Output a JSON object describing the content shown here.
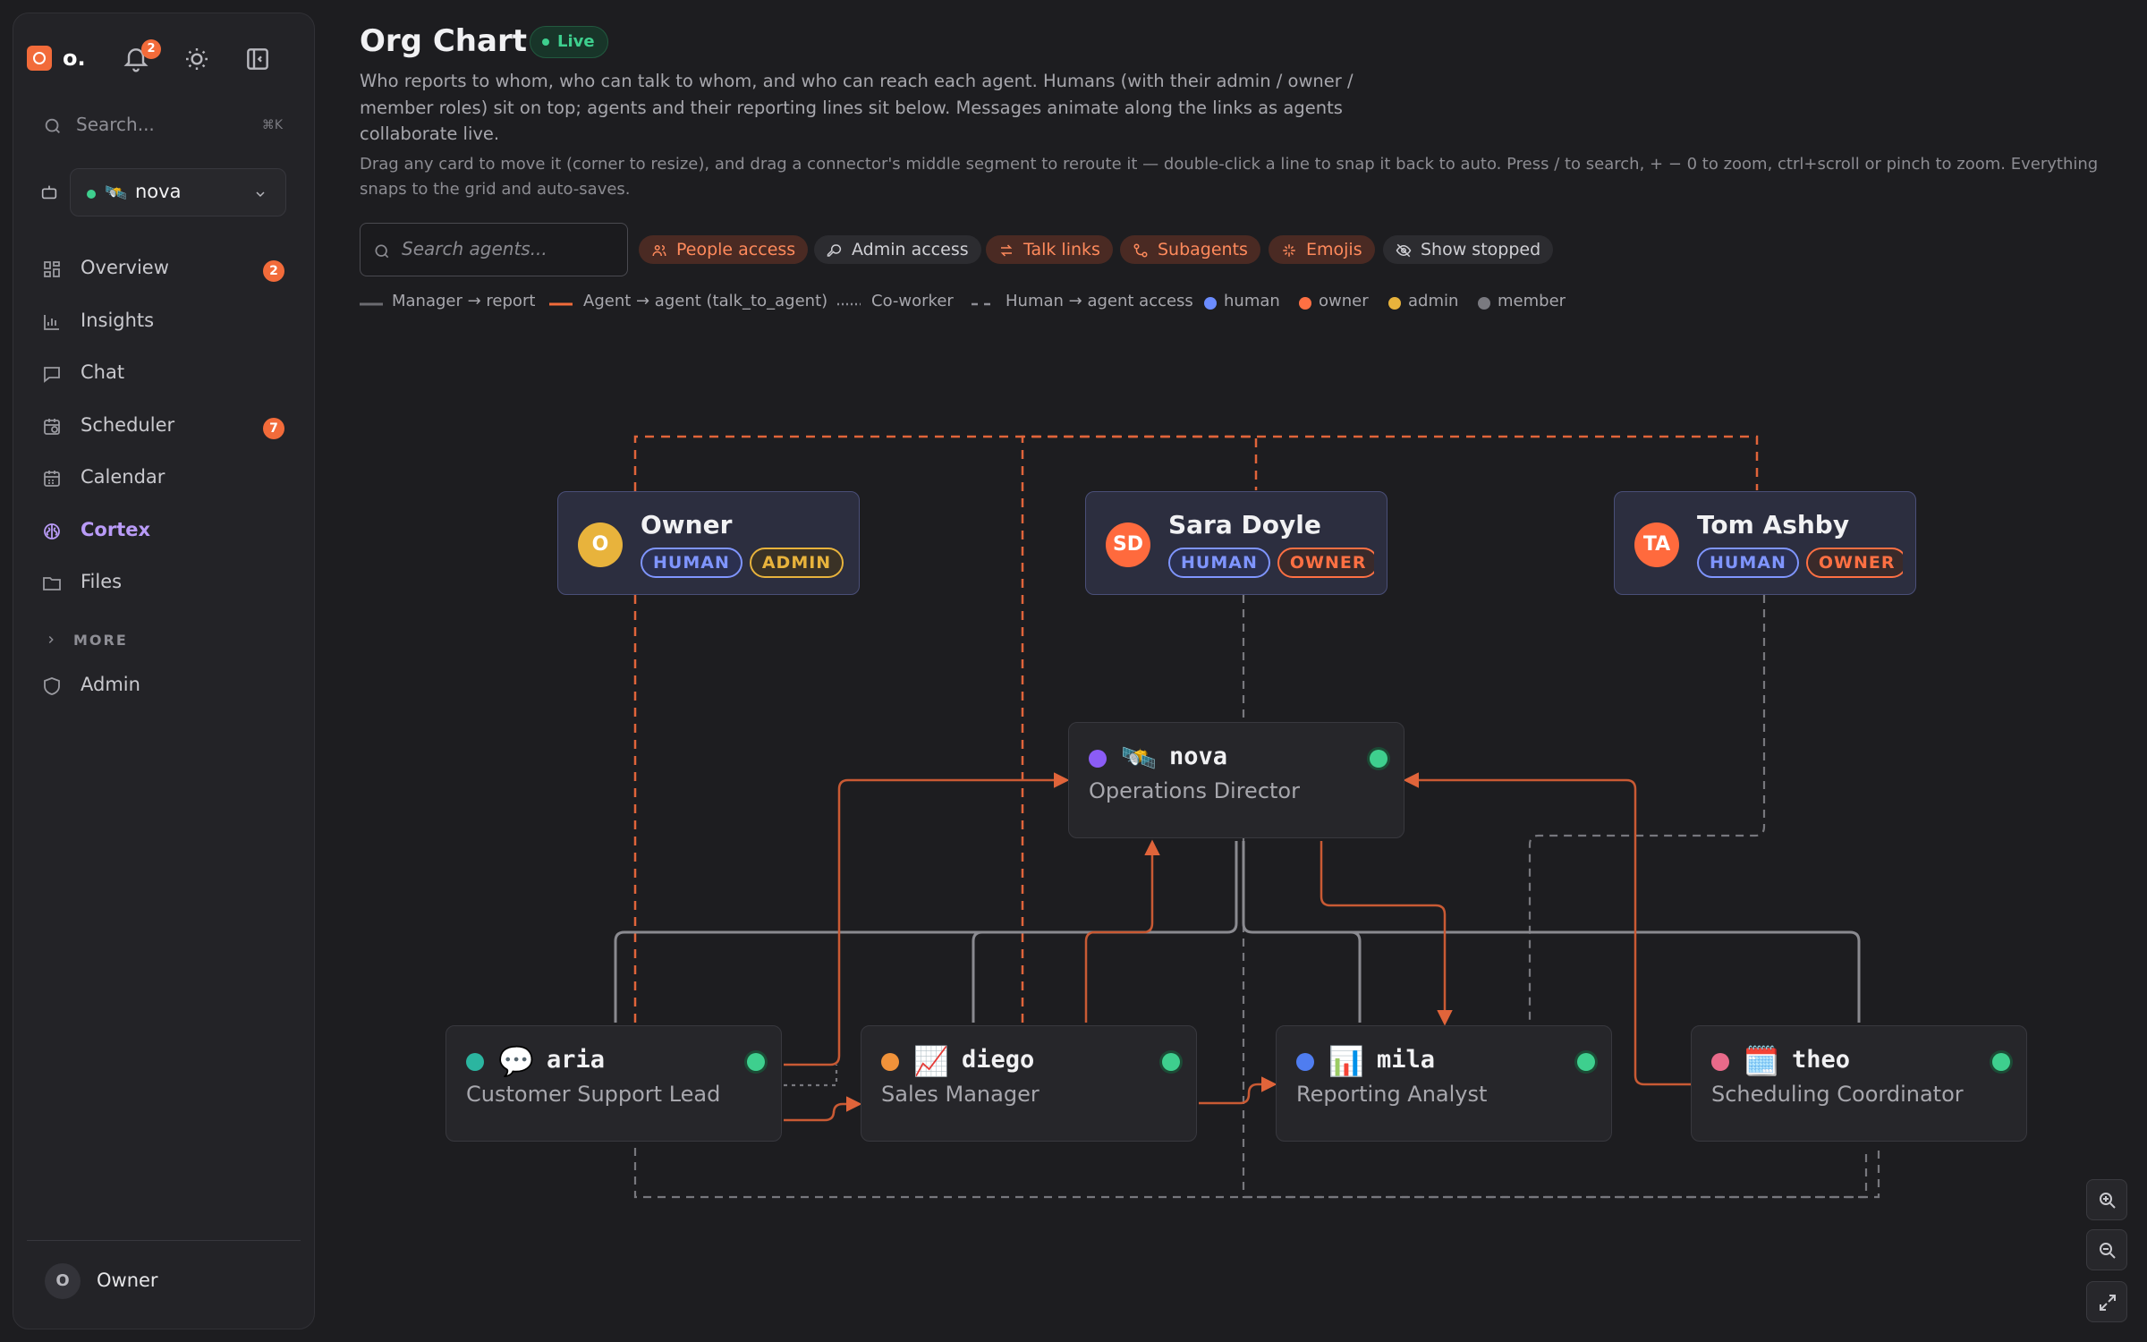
{
  "sidebar": {
    "logo_text": "o.",
    "notifications_count": "2",
    "search_placeholder": "Search...",
    "search_shortcut": "⌘K",
    "agent_selector": {
      "emoji": "🛰️",
      "name": "nova",
      "status_color": "#3ecf8e"
    },
    "nav": [
      {
        "label": "Overview",
        "icon": "grid-icon",
        "badge": "2"
      },
      {
        "label": "Insights",
        "icon": "bar-chart-icon",
        "badge": ""
      },
      {
        "label": "Chat",
        "icon": "chat-icon",
        "badge": ""
      },
      {
        "label": "Scheduler",
        "icon": "scheduler-icon",
        "badge": "7"
      },
      {
        "label": "Calendar",
        "icon": "calendar-icon",
        "badge": ""
      },
      {
        "label": "Cortex",
        "icon": "brain-icon",
        "badge": "",
        "active": true
      },
      {
        "label": "Files",
        "icon": "folder-icon",
        "badge": ""
      }
    ],
    "more_label": "MORE",
    "admin_label": "Admin",
    "user": {
      "initial": "O",
      "name": "Owner"
    }
  },
  "header": {
    "title": "Org Chart",
    "live_label": "Live",
    "description": "Who reports to whom, who can talk to whom, and who can reach each agent. Humans (with their admin / owner / member roles) sit on top; agents and their reporting lines sit below. Messages animate along the links as agents collaborate live.",
    "hint": "Drag any card to move it (corner to resize), and drag a connector's middle segment to reroute it — double-click a line to snap it back to auto. Press / to search, + − 0 to zoom, ctrl+scroll or pinch to zoom. Everything snaps to the grid and auto-saves."
  },
  "filters": {
    "search_placeholder": "Search agents...",
    "chips": [
      {
        "label": "People access",
        "icon": "people-icon",
        "active": true
      },
      {
        "label": "Admin access",
        "icon": "key-icon",
        "active": false
      },
      {
        "label": "Talk links",
        "icon": "swap-icon",
        "active": true
      },
      {
        "label": "Subagents",
        "icon": "subagents-icon",
        "active": true
      },
      {
        "label": "Emojis",
        "icon": "sparkle-icon",
        "active": true
      },
      {
        "label": "Show stopped",
        "icon": "eye-off-icon",
        "active": false
      }
    ]
  },
  "legend": [
    {
      "label": "Manager → report",
      "kind": "solid",
      "color": "#6b6b70"
    },
    {
      "label": "Agent → agent (talk_to_agent)",
      "kind": "solid",
      "color": "#f26b3a"
    },
    {
      "label": "Co-worker",
      "kind": "dotted",
      "color": "#8e8e95"
    },
    {
      "label": "Human → agent access",
      "kind": "dashed",
      "color": "#8e8e95"
    },
    {
      "label": "human",
      "kind": "dot",
      "color": "#6b8cff"
    },
    {
      "label": "owner",
      "kind": "dot",
      "color": "#ff7043"
    },
    {
      "label": "admin",
      "kind": "dot",
      "color": "#e8b33c"
    },
    {
      "label": "member",
      "kind": "dot",
      "color": "#7a7a80"
    }
  ],
  "humans": [
    {
      "initials": "O",
      "name": "Owner",
      "avatar_color": "#e8b33c",
      "tags": [
        {
          "label": "HUMAN",
          "kind": "human"
        },
        {
          "label": "ADMIN",
          "kind": "admin"
        }
      ]
    },
    {
      "initials": "SD",
      "name": "Sara Doyle",
      "avatar_color": "#ff6a3d",
      "tags": [
        {
          "label": "HUMAN",
          "kind": "human"
        },
        {
          "label": "OWNER",
          "kind": "owner"
        }
      ]
    },
    {
      "initials": "TA",
      "name": "Tom Ashby",
      "avatar_color": "#ff6a3d",
      "tags": [
        {
          "label": "HUMAN",
          "kind": "human"
        },
        {
          "label": "OWNER",
          "kind": "owner"
        }
      ]
    }
  ],
  "agents": [
    {
      "emoji": "🛰️",
      "name": "nova",
      "role": "Operations Director",
      "color": "#8b5cf6",
      "running": true
    },
    {
      "emoji": "💬",
      "name": "aria",
      "role": "Customer Support Lead",
      "color": "#2bb5a0",
      "running": true
    },
    {
      "emoji": "📈",
      "name": "diego",
      "role": "Sales Manager",
      "color": "#f0923a",
      "running": true
    },
    {
      "emoji": "📊",
      "name": "mila",
      "role": "Reporting Analyst",
      "color": "#4f7df0",
      "running": true
    },
    {
      "emoji": "🗓️",
      "name": "theo",
      "role": "Scheduling Coordinator",
      "color": "#e86a8a",
      "running": true
    }
  ]
}
